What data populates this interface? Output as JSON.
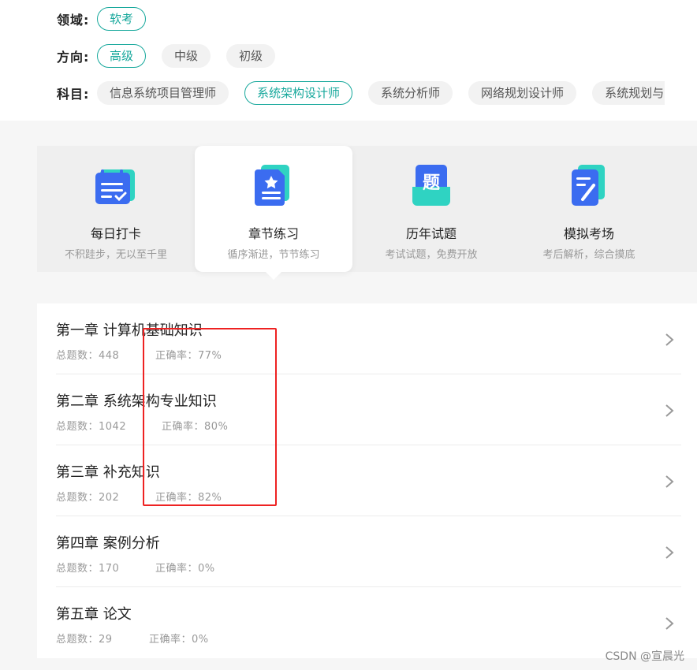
{
  "filters": {
    "domain": {
      "label": "领域:",
      "options": [
        "软考"
      ]
    },
    "direction": {
      "label": "方向:",
      "options": [
        "高级",
        "中级",
        "初级"
      ]
    },
    "subject": {
      "label": "科目:",
      "options": [
        "信息系统项目管理师",
        "系统架构设计师",
        "系统分析师",
        "网络规划设计师",
        "系统规划与"
      ]
    }
  },
  "modes": [
    {
      "title": "每日打卡",
      "subtitle": "不积跬步，无以至千里"
    },
    {
      "title": "章节练习",
      "subtitle": "循序渐进，节节练习"
    },
    {
      "title": "历年试题",
      "subtitle": "考试试题，免费开放",
      "icon_text": "题"
    },
    {
      "title": "模拟考场",
      "subtitle": "考后解析，综合摸底"
    }
  ],
  "chapters": [
    {
      "title": "第一章 计算机基础知识",
      "count": "总题数：448",
      "rate": "正确率：77%"
    },
    {
      "title": "第二章 系统架构专业知识",
      "count": "总题数：1042",
      "rate": "正确率：80%"
    },
    {
      "title": "第三章 补充知识",
      "count": "总题数：202",
      "rate": "正确率：82%"
    },
    {
      "title": "第四章 案例分析",
      "count": "总题数：170",
      "rate": "正确率：0%"
    },
    {
      "title": "第五章 论文",
      "count": "总题数：29",
      "rate": "正确率：0%"
    }
  ],
  "watermark": "CSDN @宣晨光",
  "colors": {
    "accent": "#17a89c",
    "icon_blue": "#3b6cf0",
    "icon_teal": "#2fd3c2",
    "highlight": "#ee2222"
  }
}
